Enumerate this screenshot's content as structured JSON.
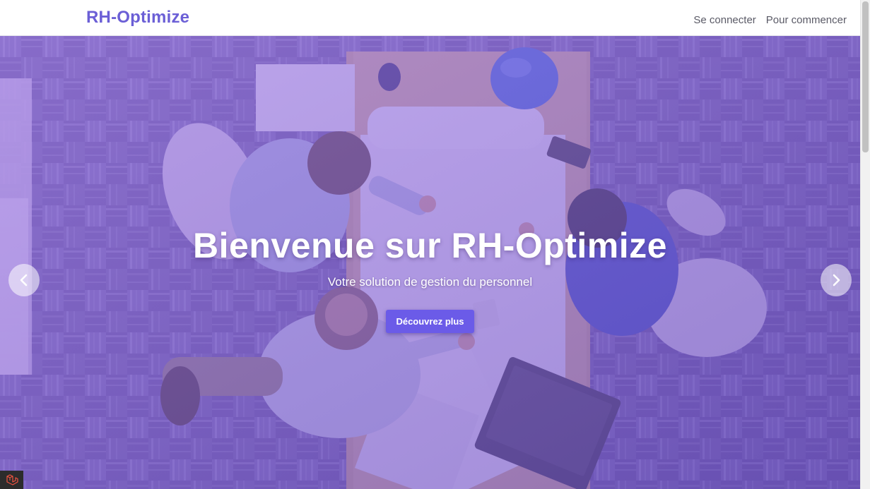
{
  "header": {
    "brand": "RH-Optimize",
    "nav": [
      {
        "label": "Se connecter"
      },
      {
        "label": "Pour commencer"
      }
    ]
  },
  "hero": {
    "title": "Bienvenue sur RH-Optimize",
    "subtitle": "Votre solution de gestion du personnel",
    "cta_label": "Découvrez plus"
  },
  "colors": {
    "brand": "#6b5fd6",
    "cta": "#6b5be8",
    "overlay": "#8a6be0"
  },
  "icons": {
    "prev": "chevron-left-icon",
    "next": "chevron-right-icon",
    "debugbar": "laravel-icon"
  }
}
